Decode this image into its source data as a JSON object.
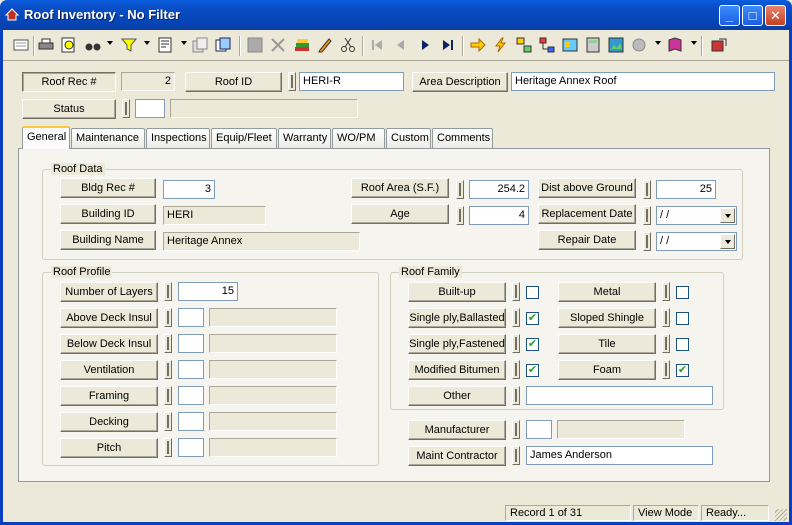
{
  "window": {
    "title": "Roof Inventory - No Filter"
  },
  "header": {
    "roof_rec_label": "Roof Rec #",
    "roof_rec_value": "2",
    "roof_id_label": "Roof ID",
    "roof_id_value": "HERI-R",
    "area_desc_label": "Area Description",
    "area_desc_value": "Heritage Annex Roof",
    "status_label": "Status",
    "status_code": "",
    "status_desc": ""
  },
  "tabs": [
    "General",
    "Maintenance",
    "Inspections",
    "Equip/Fleet",
    "Warranty",
    "WO/PM",
    "Custom",
    "Comments"
  ],
  "active_tab": "General",
  "roof_data": {
    "title": "Roof Data",
    "bldg_rec_label": "Bldg Rec #",
    "bldg_rec_value": "3",
    "building_id_label": "Building ID",
    "building_id_value": "HERI",
    "building_name_label": "Building Name",
    "building_name_value": "Heritage Annex",
    "roof_area_label": "Roof Area (S.F.)",
    "roof_area_value": "254.2",
    "age_label": "Age",
    "age_value": "4",
    "dist_label": "Dist above Ground",
    "dist_value": "25",
    "replacement_label": "Replacement Date",
    "replacement_value": " / /",
    "repair_label": "Repair Date",
    "repair_value": " / /"
  },
  "roof_profile": {
    "title": "Roof Profile",
    "layers_label": "Number of Layers",
    "layers_value": "15",
    "above_label": "Above Deck Insul",
    "below_label": "Below Deck Insul",
    "ventilation_label": "Ventilation",
    "framing_label": "Framing",
    "decking_label": "Decking",
    "pitch_label": "Pitch"
  },
  "roof_family": {
    "title": "Roof Family",
    "builtup_label": "Built-up",
    "builtup_checked": "",
    "ballasted_label": "Single ply,Ballasted",
    "ballasted_checked": "✔",
    "fastened_label": "Single ply,Fastened",
    "fastened_checked": "✔",
    "bitumen_label": "Modified Bitumen",
    "bitumen_checked": "✔",
    "metal_label": "Metal",
    "metal_checked": "",
    "sloped_label": "Sloped Shingle",
    "sloped_checked": "",
    "tile_label": "Tile",
    "tile_checked": "",
    "foam_label": "Foam",
    "foam_checked": "✔",
    "other_label": "Other",
    "other_value": ""
  },
  "bottom": {
    "manufacturer_label": "Manufacturer",
    "manufacturer_value": "",
    "contractor_label": "Maint Contractor",
    "contractor_value": "James Anderson"
  },
  "status_bar": {
    "record": "Record 1 of 31",
    "mode": "View Mode",
    "state": "Ready..."
  }
}
